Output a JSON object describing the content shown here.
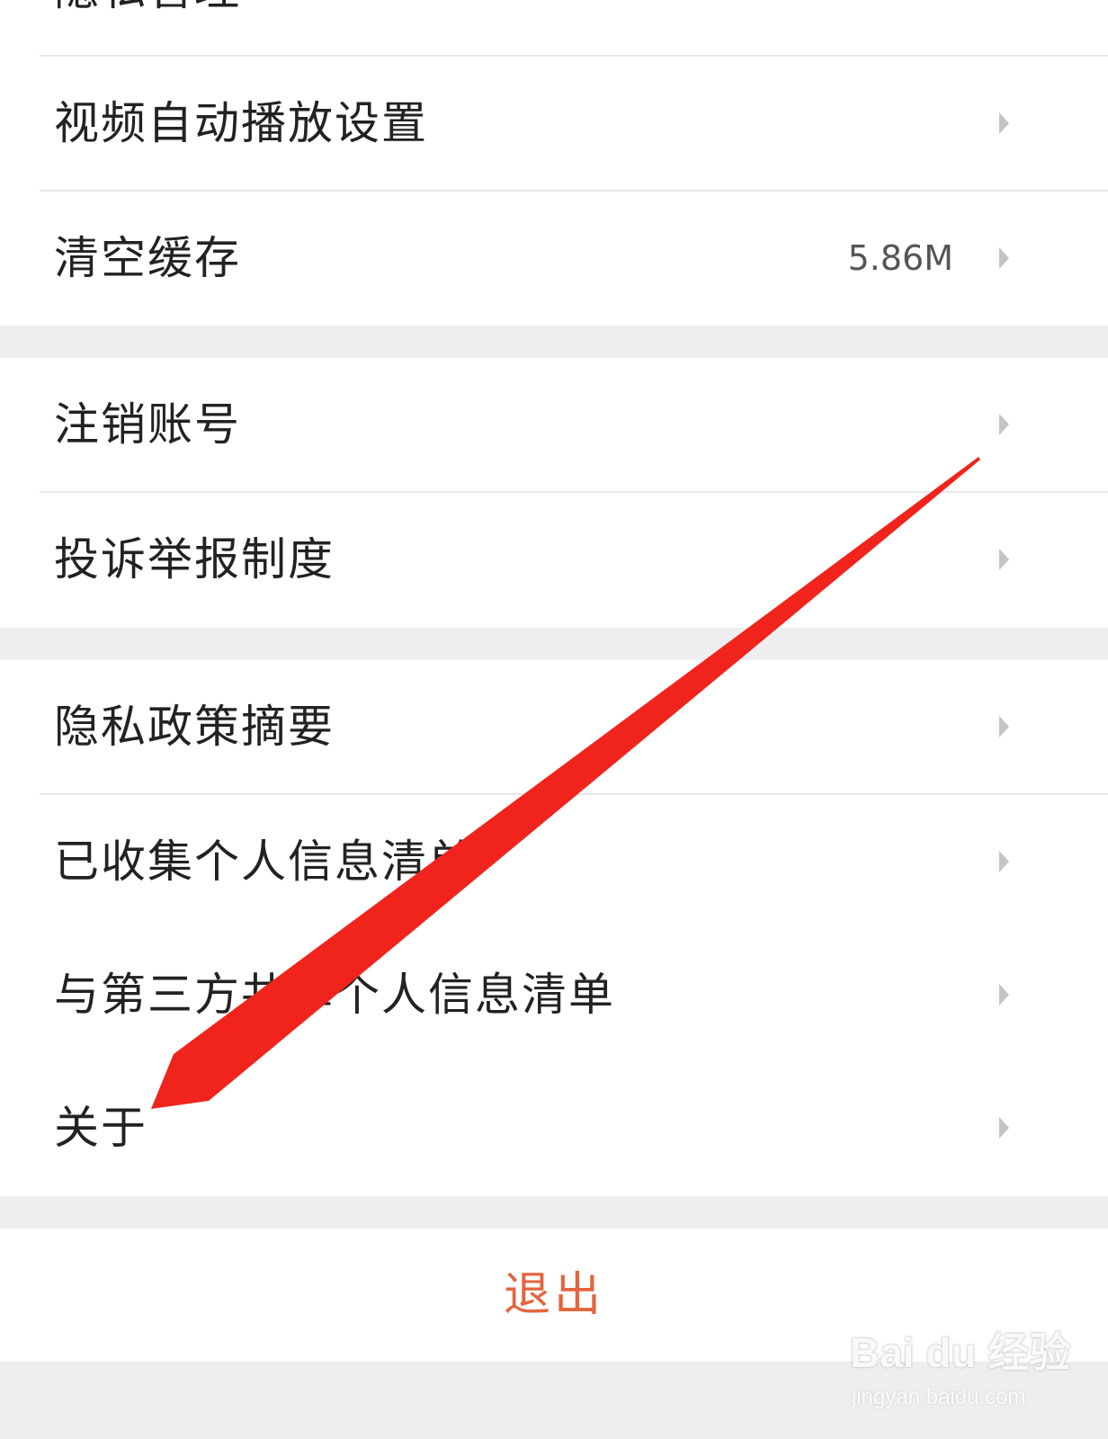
{
  "settings": {
    "items": [
      {
        "label": "隐私管理"
      },
      {
        "label": "视频自动播放设置"
      },
      {
        "label": "清空缓存",
        "value": "5.86M"
      },
      {
        "label": "注销账号"
      },
      {
        "label": "投诉举报制度"
      },
      {
        "label": "隐私政策摘要"
      },
      {
        "label": "已收集个人信息清单"
      },
      {
        "label": "与第三方共享个人信息清单"
      },
      {
        "label": "关于"
      }
    ],
    "logout_label": "退出"
  },
  "icons": {
    "row_chevron": "chevron-right-icon",
    "annotation": "red-arrow-pointing-to-about"
  },
  "colors": {
    "background": "#eeeef1",
    "logout_text": "#e5643d",
    "annotation_arrow": "#f0241c"
  },
  "watermark": {
    "brand": "Bai du 经验",
    "url": "jingyan.baidu.com"
  }
}
